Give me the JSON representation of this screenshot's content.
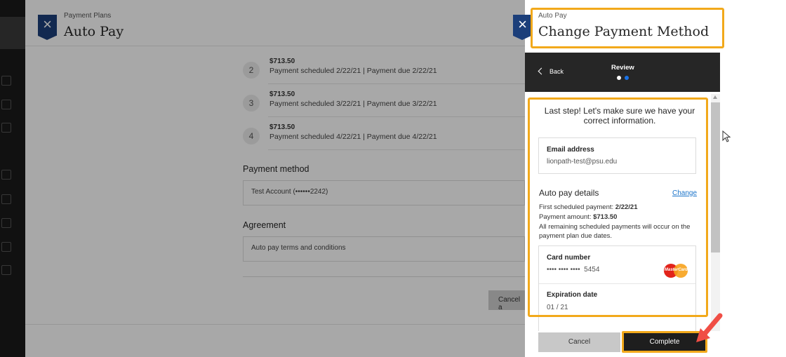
{
  "background": {
    "kicker": "Payment Plans",
    "title": "Auto Pay",
    "close_label": "×",
    "installments": [
      {
        "num": "2",
        "amount": "$713.50",
        "schedule": "Payment scheduled 2/22/21 | Payment due 2/22/21"
      },
      {
        "num": "3",
        "amount": "$713.50",
        "schedule": "Payment scheduled 3/22/21 | Payment due 3/22/21"
      },
      {
        "num": "4",
        "amount": "$713.50",
        "schedule": "Payment scheduled 4/22/21 | Payment due 4/22/21"
      }
    ],
    "payment_method_title": "Payment method",
    "payment_method_value": "Test Account (••••••2242)",
    "agreement_title": "Agreement",
    "agreement_value": "Auto pay terms and conditions",
    "cancel_label": "Cancel a"
  },
  "drawer": {
    "close_label": "×",
    "kicker": "Auto Pay",
    "title": "Change Payment Method",
    "nav": {
      "back_label": "Back",
      "step_title": "Review",
      "dots": [
        "#ffffff",
        "#1a73e8"
      ]
    },
    "intro": "Last step! Let's make sure we have your correct information.",
    "email": {
      "label": "Email address",
      "value": "lionpath-test@psu.edu"
    },
    "autopay": {
      "title": "Auto pay details",
      "change_label": "Change",
      "first_prefix": "First scheduled payment:",
      "first_value": "2/22/21",
      "amount_prefix": "Payment amount:",
      "amount_value": "$713.50",
      "note": "All remaining scheduled payments will occur on the payment plan due dates."
    },
    "card": {
      "number_label": "Card number",
      "number_masked": "•••• •••• ••••",
      "number_last4": "5454",
      "brand": "MasterCard",
      "expiration_label": "Expiration date",
      "expiration_value": "01 / 21"
    },
    "footer": {
      "cancel_label": "Cancel",
      "complete_label": "Complete"
    }
  },
  "colors": {
    "highlight": "#f2a91b",
    "close_blue": "#1c3f7a",
    "link": "#1a73c9",
    "annotation_arrow": "#f04e45"
  }
}
